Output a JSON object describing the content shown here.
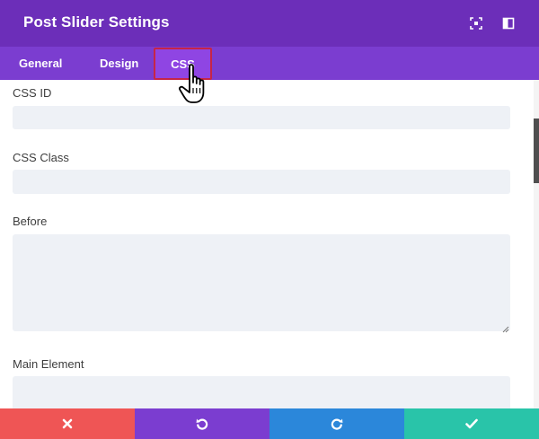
{
  "header": {
    "title": "Post Slider Settings",
    "icons": [
      "expand-icon",
      "sidebar-toggle-icon"
    ],
    "background": "#6c2eb9"
  },
  "tabs": [
    {
      "label": "General",
      "active": false
    },
    {
      "label": "Design",
      "active": false
    },
    {
      "label": "CSS",
      "active": true
    }
  ],
  "tab_bar_color": "#7b3dd0",
  "highlight_color": "#c62547",
  "form": {
    "css_id": {
      "label": "CSS ID",
      "value": ""
    },
    "css_class": {
      "label": "CSS Class",
      "value": ""
    },
    "before": {
      "label": "Before",
      "value": ""
    },
    "main_element": {
      "label": "Main Element",
      "value": ""
    }
  },
  "footer": {
    "buttons": [
      {
        "name": "cancel",
        "icon": "close-icon",
        "color": "#ef5555"
      },
      {
        "name": "undo",
        "icon": "undo-icon",
        "color": "#7b3dd0"
      },
      {
        "name": "redo",
        "icon": "redo-icon",
        "color": "#2b87da"
      },
      {
        "name": "save",
        "icon": "check-icon",
        "color": "#29c4a9"
      }
    ]
  }
}
